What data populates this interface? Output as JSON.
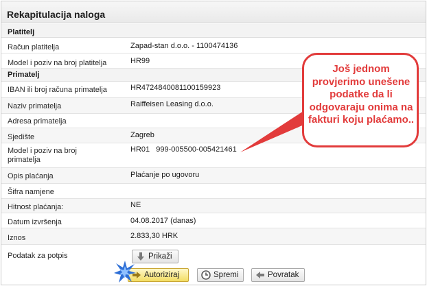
{
  "title": "Rekapitulacija naloga",
  "sections": {
    "payer": "Platitelj",
    "recipient": "Primatelj"
  },
  "rows": {
    "racun_platitelja": {
      "label": "Račun platitelja",
      "value": "Zapad-stan d.o.o. - 1100474136"
    },
    "model_platitelja": {
      "label": "Model i poziv na broj platitelja",
      "value": "HR99"
    },
    "iban": {
      "label": "IBAN ili broj računa primatelja",
      "value": "HR4724840081100159923"
    },
    "naziv": {
      "label": "Naziv primatelja",
      "value": "Raiffeisen Leasing d.o.o."
    },
    "adresa": {
      "label": "Adresa primatelja",
      "value": ""
    },
    "sjediste": {
      "label": "Sjedište",
      "value": "Zagreb"
    },
    "model_primatelja": {
      "label": "Model i poziv na broj primatelja",
      "value": "HR01   999-005500-005421461"
    },
    "opis": {
      "label": "Opis plaćanja",
      "value": "Plaćanje po ugovoru"
    },
    "sifra": {
      "label": "Šifra namjene",
      "value": ""
    },
    "hitnost": {
      "label": "Hitnost plaćanja:",
      "value": "NE"
    },
    "datum": {
      "label": "Datum izvršenja",
      "value": "04.08.2017 (danas)"
    },
    "iznos": {
      "label": "Iznos",
      "value": "2.833,30 HRK"
    },
    "potpis": {
      "label": "Podatak za potpis",
      "value": ""
    }
  },
  "buttons": {
    "prikazi": "Prikaži",
    "autoriziraj": "Autoriziraj",
    "spremi": "Spremi",
    "povratak": "Povratak"
  },
  "callout": {
    "text": "Još jednom provjerimo unešene podatke da li odgovaraju onima na fakturi koju plaćamo.."
  },
  "colors": {
    "accent": "#e23b3b",
    "authorize_button": "#f3dd63",
    "star": "#2e6fd6"
  }
}
